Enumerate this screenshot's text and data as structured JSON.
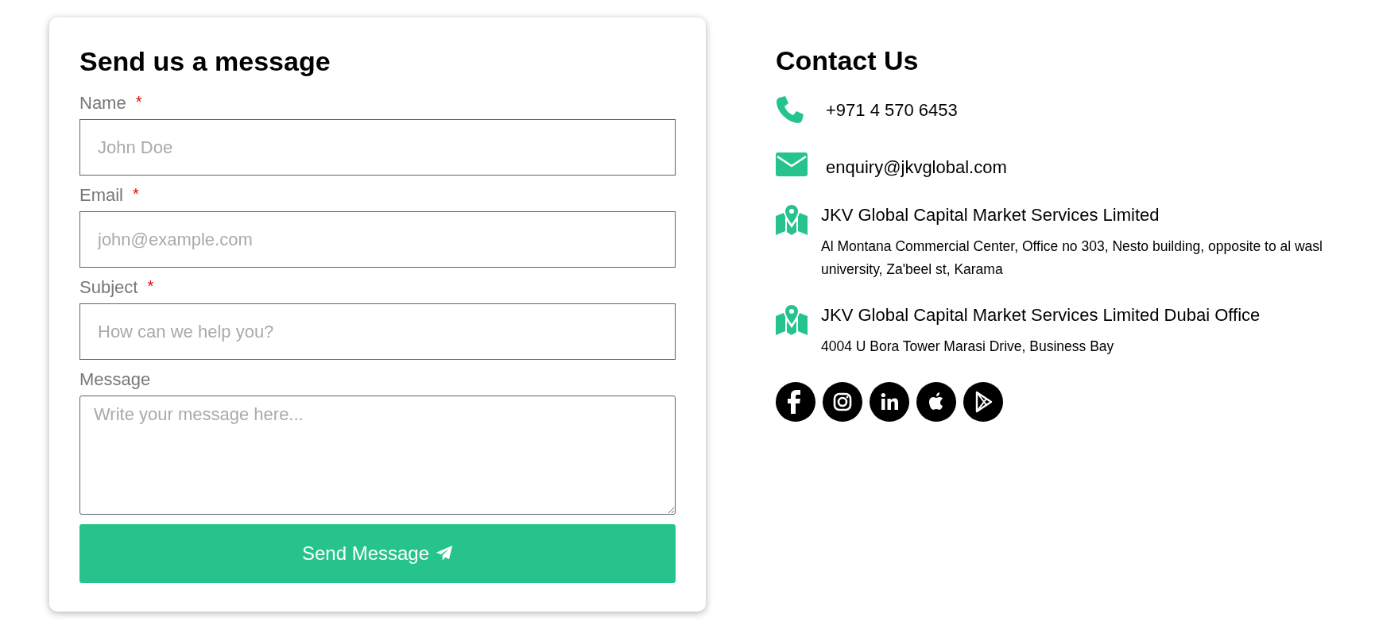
{
  "form": {
    "title": "Send us a message",
    "fields": [
      {
        "kind": "input",
        "label": "Name",
        "marker": "*",
        "placeholder": "John Doe"
      },
      {
        "kind": "input",
        "label": "Email",
        "marker": "*",
        "placeholder": "john@example.com"
      },
      {
        "kind": "input",
        "label": "Subject",
        "marker": "*",
        "placeholder": "How can we help you?"
      },
      {
        "kind": "textarea",
        "label": "Message",
        "placeholder": "Write your message here..."
      }
    ],
    "submit": "Send Message"
  },
  "contact": {
    "title": "Contact Us",
    "items": [
      {
        "kind": "phone",
        "text": "+971 4 570 6453"
      },
      {
        "kind": "email",
        "text": "enquiry@jkvglobal.com"
      },
      {
        "kind": "location",
        "text": "JKV Global Capital Market Services Limited",
        "address": "Al Montana Commercial Center, Office no 303, Nesto building, opposite to al wasl university, Za'beel st, Karama"
      },
      {
        "kind": "location",
        "text": "JKV Global Capital Market Services Limited Dubai Office",
        "address": "4004 U Bora Tower Marasi Drive, Business Bay"
      }
    ],
    "social": [
      {
        "kind": "facebook"
      },
      {
        "kind": "instagram"
      },
      {
        "kind": "linkedin"
      },
      {
        "kind": "apple"
      },
      {
        "kind": "play"
      }
    ]
  }
}
